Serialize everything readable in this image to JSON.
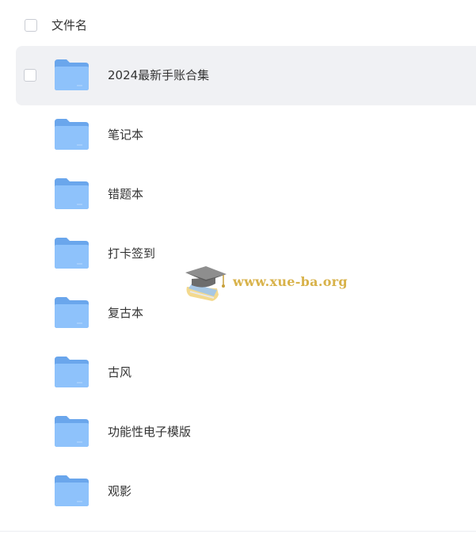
{
  "header": {
    "column_label": "文件名"
  },
  "files": [
    {
      "name": "2024最新手账合集",
      "type": "folder-icon",
      "hovered": true
    },
    {
      "name": "笔记本",
      "type": "folder-icon",
      "hovered": false
    },
    {
      "name": "错题本",
      "type": "folder-icon",
      "hovered": false
    },
    {
      "name": "打卡签到",
      "type": "folder-icon",
      "hovered": false
    },
    {
      "name": "复古本",
      "type": "folder-icon",
      "hovered": false
    },
    {
      "name": "古风",
      "type": "folder-icon",
      "hovered": false
    },
    {
      "name": "功能性电子模版",
      "type": "folder-icon",
      "hovered": false
    },
    {
      "name": "观影",
      "type": "folder-icon",
      "hovered": false
    }
  ],
  "watermark": {
    "text": "www.xue-ba.org"
  },
  "colors": {
    "folder_back": "#6aa6ec",
    "folder_front": "#8ec2fb",
    "hover_bg": "#f0f1f4",
    "text": "#333333",
    "watermark": "#d8b24a"
  }
}
